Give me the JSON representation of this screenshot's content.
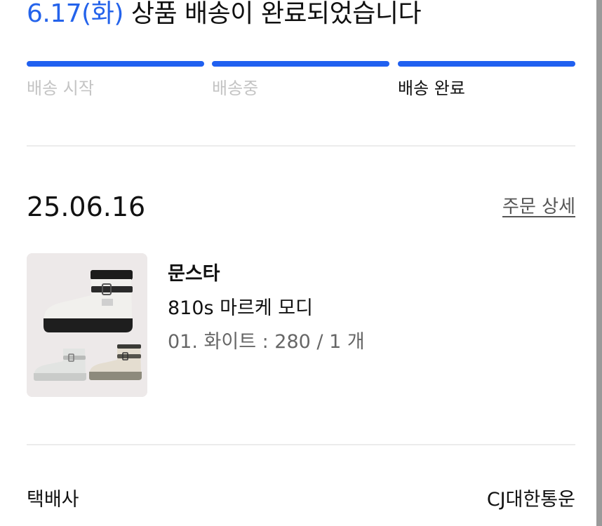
{
  "header": {
    "date": "6.17(화)",
    "message": "상품 배송이 완료되었습니다"
  },
  "progress": {
    "steps": [
      {
        "label": "배송 시작",
        "state": "done"
      },
      {
        "label": "배송중",
        "state": "done"
      },
      {
        "label": "배송 완료",
        "state": "current"
      }
    ],
    "bar_color": "#2060f0"
  },
  "order": {
    "date": "25.06.16",
    "detail_link": "주문 상세",
    "product": {
      "image_icon": "rain-boots-image",
      "brand": "문스타",
      "name": "810s 마르케 모디",
      "option": "01. 화이트 : 280 / 1 개"
    }
  },
  "shipping": {
    "carrier_label": "택배사",
    "carrier_value": "CJ대한통운"
  },
  "colors": {
    "accent": "#2463eb",
    "muted_text": "#c4c4c4",
    "divider": "#ececec"
  }
}
